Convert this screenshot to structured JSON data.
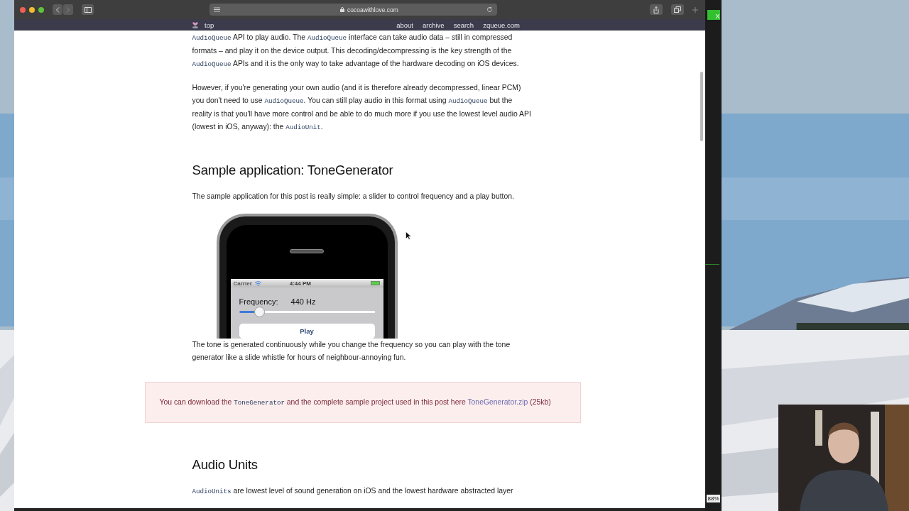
{
  "browser": {
    "url": "cocoawithlove.com"
  },
  "site_nav": {
    "home": "top",
    "links": [
      "about",
      "archive",
      "search",
      "zqueue.com"
    ]
  },
  "content": [
    {
      "kind": "paragraph",
      "segments": [
        {
          "kind": "code",
          "text": "AudioQueue"
        },
        {
          "kind": "text",
          "text": " API to play audio. The "
        },
        {
          "kind": "code",
          "text": "AudioQueue"
        },
        {
          "kind": "text",
          "text": " interface can take audio data – still in compressed formats – and play it on the device output. This decoding/decompressing is the key strength of the "
        },
        {
          "kind": "code",
          "text": "AudioQueue"
        },
        {
          "kind": "text",
          "text": " APIs and it is the only way to take advantage of the hardware decoding on iOS devices."
        }
      ]
    },
    {
      "kind": "paragraph",
      "segments": [
        {
          "kind": "text",
          "text": "However, if you're generating your own audio (and it is therefore already decompressed, linear PCM) you don't need to use "
        },
        {
          "kind": "code",
          "text": "AudioQueue"
        },
        {
          "kind": "text",
          "text": ". You can still play audio in this format using "
        },
        {
          "kind": "code",
          "text": "AudioQueue"
        },
        {
          "kind": "text",
          "text": " but the reality is that you'll have more control and be able to do much more if you use the lowest level audio API (lowest in iOS, anyway): the "
        },
        {
          "kind": "code",
          "text": "AudioUnit"
        },
        {
          "kind": "text",
          "text": "."
        }
      ]
    },
    {
      "kind": "heading",
      "text": "Sample application: ToneGenerator"
    },
    {
      "kind": "paragraph",
      "segments": [
        {
          "kind": "text",
          "text": "The sample application for this post is really simple: a slider to control frequency and a play button."
        }
      ]
    },
    {
      "kind": "phone",
      "carrier": "Carrier",
      "time": "4:44 PM",
      "label": "Frequency:",
      "reading": "440 Hz",
      "level": 0.12,
      "button": "Play"
    },
    {
      "kind": "paragraph",
      "segments": [
        {
          "kind": "text",
          "text": "The tone is generated continuously while you change the frequency so you can play with the tone generator like a slide whistle for hours of neighbour-annoying fun."
        }
      ]
    },
    {
      "kind": "note",
      "segments": [
        {
          "kind": "text",
          "text": "You can download the "
        },
        {
          "kind": "code",
          "text": "ToneGenerator"
        },
        {
          "kind": "text",
          "text": "  and the complete sample project used in this post here "
        },
        {
          "kind": "link",
          "text": "ToneGenerator.zip"
        },
        {
          "kind": "text",
          "text": " (25kb)"
        }
      ]
    },
    {
      "kind": "heading",
      "text": "Audio Units"
    },
    {
      "kind": "paragraph",
      "segments": [
        {
          "kind": "code",
          "text": "AudioUnits"
        },
        {
          "kind": "text",
          "text": " are lowest level of sound generation on iOS and the lowest hardware abstracted layer"
        }
      ]
    }
  ],
  "side_panel": {
    "close": "X",
    "zoom": "88%"
  }
}
